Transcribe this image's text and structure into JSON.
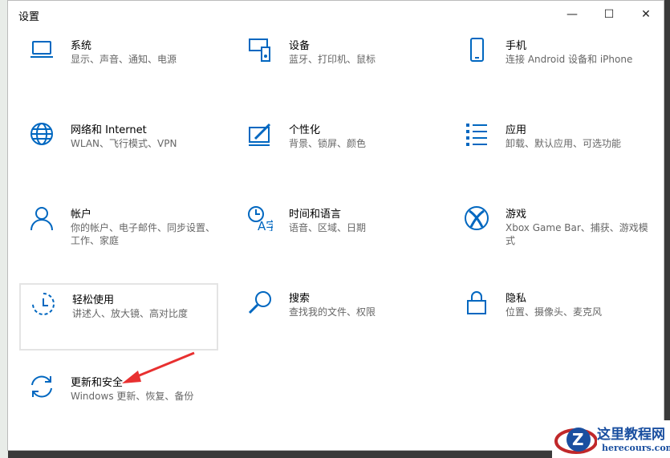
{
  "window": {
    "title": "设置",
    "minimize": "—",
    "maximize": "☐",
    "close": "✕"
  },
  "tiles": [
    {
      "title": "系统",
      "sub": "显示、声音、通知、电源",
      "icon": "laptop-icon"
    },
    {
      "title": "设备",
      "sub": "蓝牙、打印机、鼠标",
      "icon": "keyboard-icon"
    },
    {
      "title": "手机",
      "sub": "连接 Android 设备和 iPhone",
      "icon": "phone-icon"
    },
    {
      "title": "网络和 Internet",
      "sub": "WLAN、飞行模式、VPN",
      "icon": "globe-icon"
    },
    {
      "title": "个性化",
      "sub": "背景、锁屏、颜色",
      "icon": "paint-icon"
    },
    {
      "title": "应用",
      "sub": "卸载、默认应用、可选功能",
      "icon": "apps-list-icon"
    },
    {
      "title": "帐户",
      "sub": "你的帐户、电子邮件、同步设置、工作、家庭",
      "icon": "person-icon"
    },
    {
      "title": "时间和语言",
      "sub": "语音、区域、日期",
      "icon": "time-language-icon"
    },
    {
      "title": "游戏",
      "sub": "Xbox Game Bar、捕获、游戏模式",
      "icon": "xbox-icon"
    },
    {
      "title": "轻松使用",
      "sub": "讲述人、放大镜、高对比度",
      "icon": "ease-of-access-icon"
    },
    {
      "title": "搜索",
      "sub": "查找我的文件、权限",
      "icon": "search-icon"
    },
    {
      "title": "隐私",
      "sub": "位置、摄像头、麦克风",
      "icon": "lock-icon"
    },
    {
      "title": "更新和安全",
      "sub": "Windows 更新、恢复、备份",
      "icon": "update-icon"
    }
  ],
  "watermark": {
    "cn": "这里教程网",
    "en": "herecours.com"
  },
  "accent": "#0067c0"
}
